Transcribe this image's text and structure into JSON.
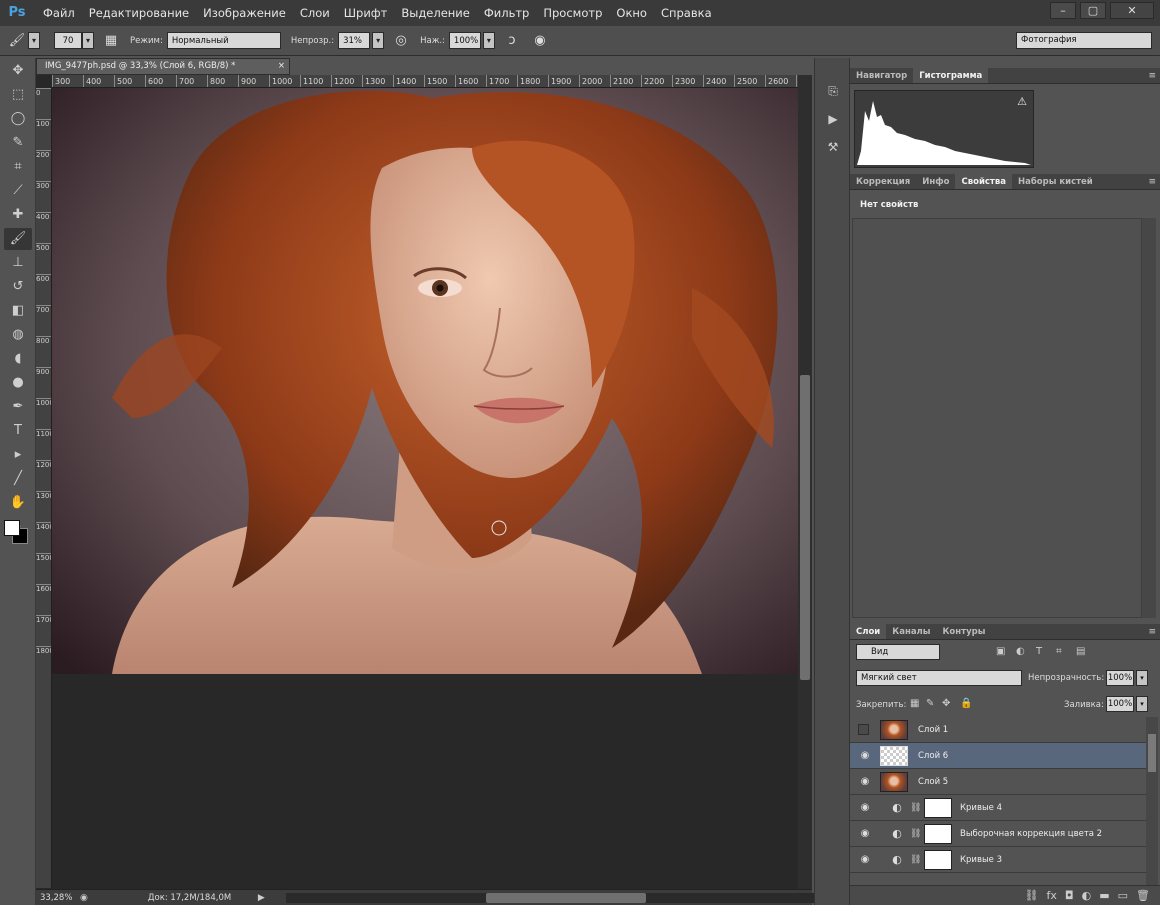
{
  "menu": {
    "logo": "Ps",
    "items": [
      "Файл",
      "Редактирование",
      "Изображение",
      "Слои",
      "Шрифт",
      "Выделение",
      "Фильтр",
      "Просмотр",
      "Окно",
      "Справка"
    ]
  },
  "window_controls": {
    "minimize": "–",
    "restore": "▢",
    "close": "✕"
  },
  "options": {
    "brush_size": "70",
    "mode_label": "Режим:",
    "mode_value": "Нормальный",
    "opacity_label": "Непрозр.:",
    "opacity_value": "31%",
    "pressure_label": "Наж.:",
    "pressure_value": "100%",
    "workspace": "Фотография"
  },
  "document": {
    "tab_title": "IMG_9477ph.psd @ 33,3% (Слой 6, RGB/8) *",
    "tab_close": "×",
    "ruler_top": [
      "300",
      "400",
      "500",
      "600",
      "700",
      "800",
      "900",
      "1000",
      "1100",
      "1200",
      "1300",
      "1400",
      "1500",
      "1600",
      "1700",
      "1800",
      "1900",
      "2000",
      "2100",
      "2200",
      "2300",
      "2400",
      "2500",
      "2600",
      "2700"
    ],
    "ruler_left": [
      "0",
      "100",
      "200",
      "300",
      "400",
      "500",
      "600",
      "700",
      "800",
      "900",
      "1000",
      "1100",
      "1200",
      "1300",
      "1400",
      "1500",
      "1600",
      "1700",
      "1800"
    ],
    "zoom": "33,28%",
    "doc_info": "Док: 17,2M/184,0M"
  },
  "tools": [
    "move-icon",
    "marquee-icon",
    "lasso-icon",
    "quick-select-icon",
    "crop-icon",
    "eyedropper-icon",
    "healing-icon",
    "brush-icon",
    "stamp-icon",
    "history-brush-icon",
    "eraser-icon",
    "bucket-icon",
    "blur-icon",
    "dodge-icon",
    "pen-icon",
    "type-icon",
    "path-select-icon",
    "line-icon",
    "hand-icon",
    "zoom-icon"
  ],
  "tool_glyphs": [
    "✥",
    "⬚",
    "◯",
    "✎",
    "⌗",
    "⟋",
    "✚",
    "🖌",
    "⊥",
    "↺",
    "◧",
    "◍",
    "◖",
    "●",
    "✒",
    "T",
    "▸",
    "╱",
    "✋",
    "⌕"
  ],
  "top_panel": {
    "tabs": [
      "Навигатор",
      "Гистограмма"
    ],
    "active": "Гистограмма",
    "warning": "⚠"
  },
  "props_panel": {
    "tabs": [
      "Коррекция",
      "Инфо",
      "Свойства",
      "Наборы кистей"
    ],
    "active": "Свойства",
    "title": "Нет свойств"
  },
  "layers_panel": {
    "tabs": [
      "Слои",
      "Каналы",
      "Контуры"
    ],
    "active": "Слои",
    "filter": "Вид",
    "blend_mode": "Мягкий свет",
    "opacity_label": "Непрозрачность:",
    "opacity_value": "100%",
    "lock_label": "Закрепить:",
    "fill_label": "Заливка:",
    "fill_value": "100%",
    "layers": [
      {
        "name": "Слой 1",
        "visible": false,
        "type": "photo",
        "selected": false
      },
      {
        "name": "Слой 6",
        "visible": true,
        "type": "transparent",
        "selected": true
      },
      {
        "name": "Слой 5",
        "visible": true,
        "type": "photo",
        "selected": false
      },
      {
        "name": "Кривые 4",
        "visible": true,
        "type": "adjustment",
        "selected": false
      },
      {
        "name": "Выборочная коррекция цвета 2",
        "visible": true,
        "type": "adjustment",
        "selected": false
      },
      {
        "name": "Кривые 3",
        "visible": true,
        "type": "adjustment",
        "selected": false
      }
    ],
    "footer_icons": [
      "link-icon",
      "fx-icon",
      "mask-icon",
      "adjustment-icon",
      "group-icon",
      "new-layer-icon",
      "trash-icon"
    ],
    "footer_glyphs": [
      "⛓",
      "fx",
      "◘",
      "◐",
      "▬",
      "▭",
      "🗑"
    ]
  },
  "colors": {
    "accent": "#4aa3e0",
    "selected_layer": "#59677c",
    "panel": "#535353"
  }
}
